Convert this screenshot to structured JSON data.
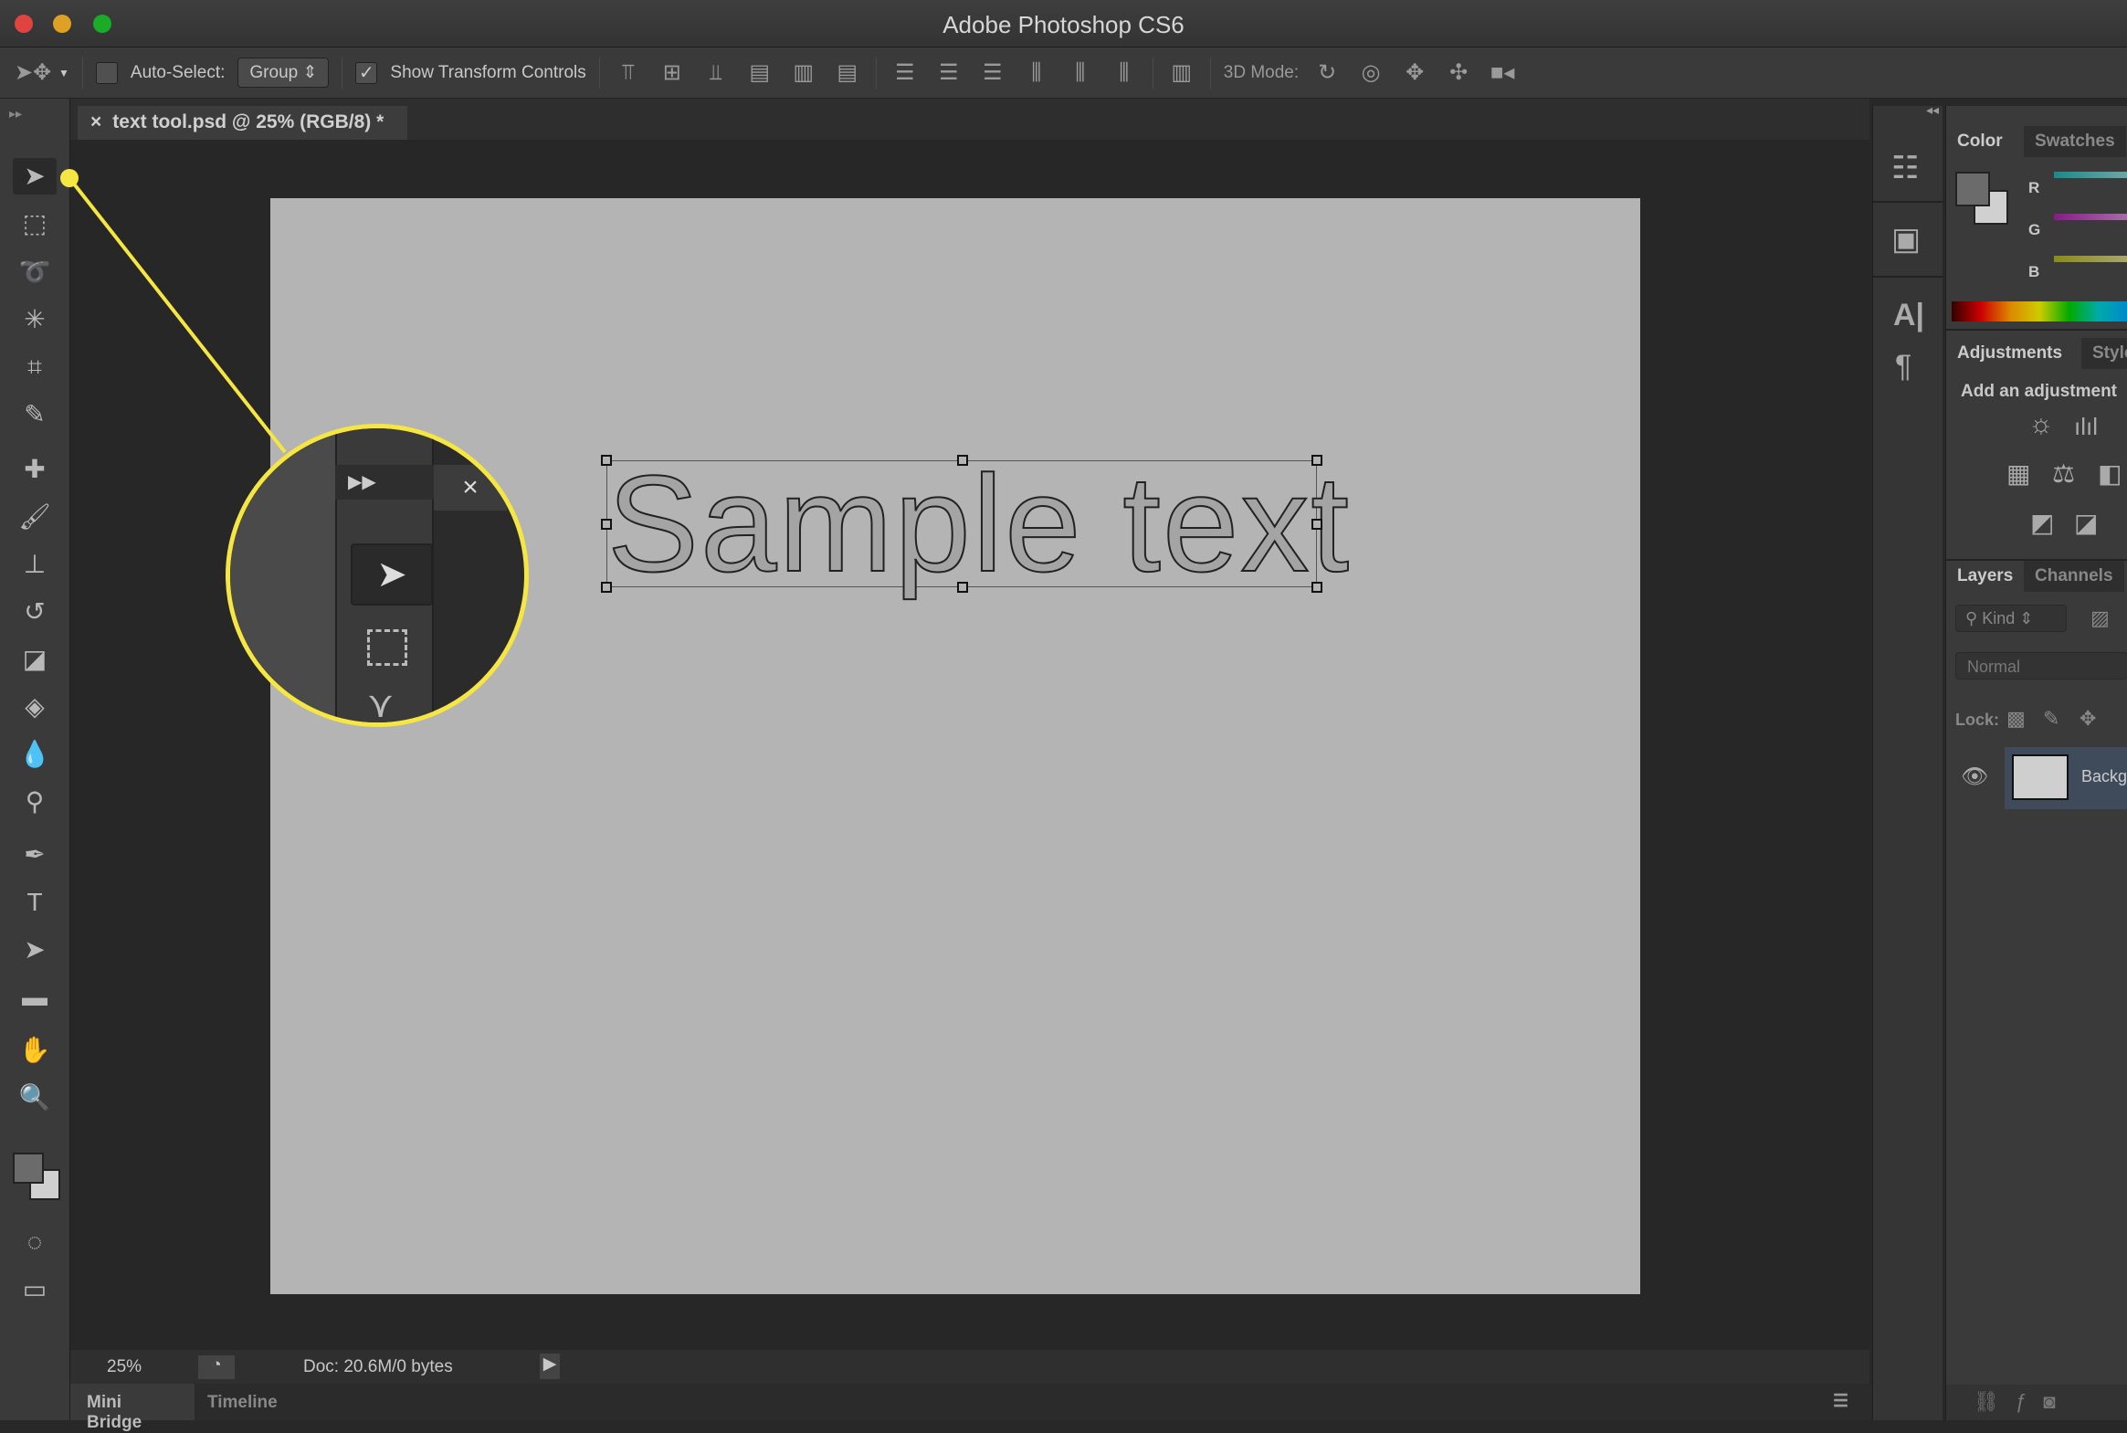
{
  "window": {
    "title": "Adobe Photoshop CS6"
  },
  "options_bar": {
    "auto_select_label": "Auto-Select:",
    "auto_select_checked": false,
    "group_value": "Group",
    "show_transform_label": "Show Transform Controls",
    "show_transform_checked": true,
    "mode_3d_label": "3D Mode:"
  },
  "document": {
    "tab_title": "text tool.psd @ 25% (RGB/8) *",
    "text_layer": "Sample text"
  },
  "status": {
    "zoom": "25%",
    "doc_info": "Doc: 20.6M/0 bytes"
  },
  "bottom_tabs": [
    "Mini Bridge",
    "Timeline"
  ],
  "color_panel": {
    "tabs": [
      "Color",
      "Swatches"
    ],
    "channels": [
      "R",
      "G",
      "B"
    ]
  },
  "adjustments_panel": {
    "tabs": [
      "Adjustments",
      "Styles"
    ],
    "heading": "Add an adjustment"
  },
  "layers_panel": {
    "tabs": [
      "Layers",
      "Channels"
    ],
    "filter": "Kind",
    "blend_mode": "Normal",
    "lock_label": "Lock:",
    "layers": [
      {
        "name": "Background",
        "visible": true
      }
    ]
  },
  "colors": {
    "highlight": "#f5e642",
    "close": "#e0443e",
    "minimize": "#dea123",
    "maximize": "#1aab29"
  }
}
